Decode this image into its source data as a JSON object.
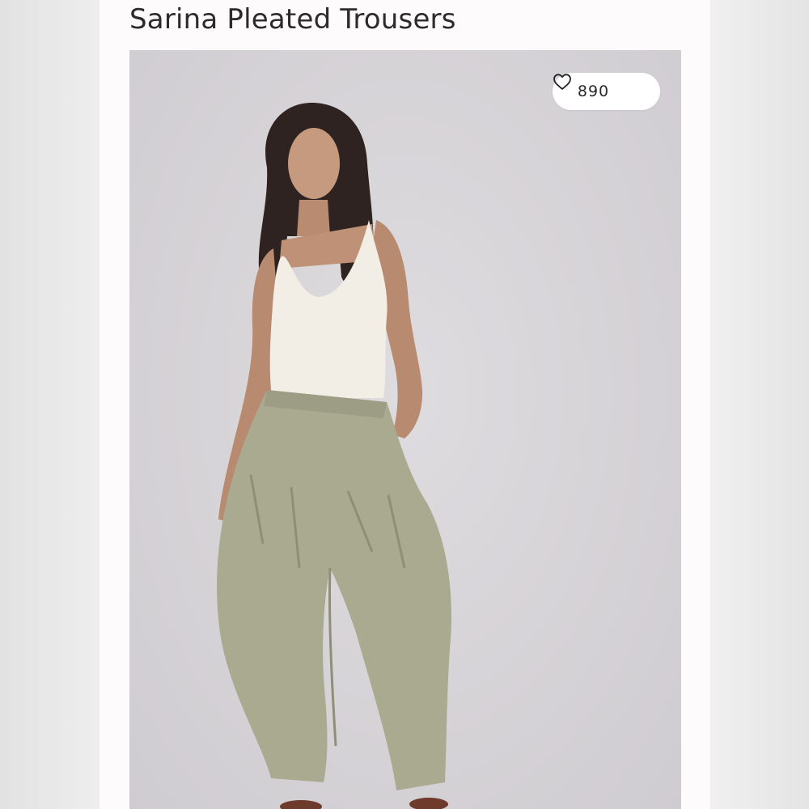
{
  "listing": {
    "title": "Sarina Pleated Trousers",
    "like_count": "890",
    "like_icon": "heart-outline-icon"
  },
  "photo": {
    "subject": "product-photo",
    "background_color": "#d8d5d9",
    "top_color": "#f4efe6",
    "trousers_color": "#a9aa90"
  }
}
